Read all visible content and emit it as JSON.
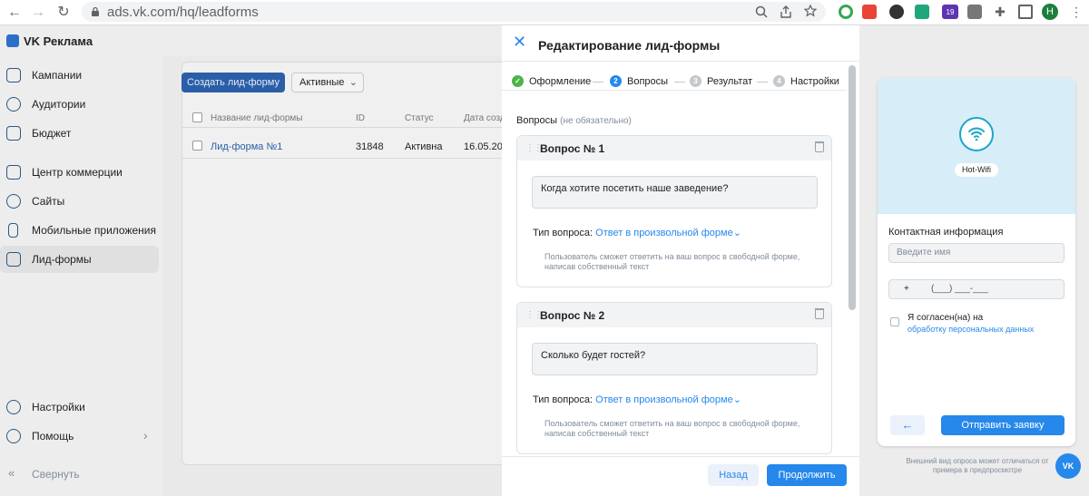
{
  "browser": {
    "url": "ads.vk.com/hq/leadforms",
    "back_icon": "←",
    "forward_icon": "→",
    "reload_icon": "↻",
    "extension_badge": "19",
    "profile_initial": "H"
  },
  "app": {
    "brand": "VK Реклама",
    "sidebar": {
      "items": [
        {
          "label": "Кампании"
        },
        {
          "label": "Аудитории"
        },
        {
          "label": "Бюджет"
        },
        {
          "label": "Центр коммерции"
        },
        {
          "label": "Сайты"
        },
        {
          "label": "Мобильные приложения"
        },
        {
          "label": "Лид-формы"
        }
      ],
      "bottom": [
        {
          "label": "Настройки"
        },
        {
          "label": "Помощь"
        },
        {
          "label": "Свернуть"
        }
      ]
    },
    "leads": {
      "create_button": "Создать лид-форму",
      "filter": "Активные",
      "columns": [
        "Название лид-формы",
        "ID",
        "Статус",
        "Дата созд"
      ],
      "rows": [
        {
          "name": "Лид-форма №1",
          "id": "31848",
          "status": "Активна",
          "date": "16.05.202"
        }
      ]
    }
  },
  "modal": {
    "title": "Редактирование лид-формы",
    "steps": [
      {
        "num": "✓",
        "label": "Оформление"
      },
      {
        "num": "2",
        "label": "Вопросы"
      },
      {
        "num": "3",
        "label": "Результат"
      },
      {
        "num": "4",
        "label": "Настройки"
      }
    ],
    "section_title": "Вопросы",
    "section_optional": "(не обязательно)",
    "questions": [
      {
        "title": "Вопрос № 1",
        "text": "Когда хотите посетить наше заведение?",
        "type_label": "Тип вопроса:",
        "type_value": "Ответ в произвольной форме",
        "hint": "Пользователь сможет ответить на ваш вопрос в свободной форме, написав собственный текст"
      },
      {
        "title": "Вопрос № 2",
        "text": "Сколько будет гостей?",
        "type_label": "Тип вопроса:",
        "type_value": "Ответ в произвольной форме",
        "hint": "Пользователь сможет ответить на ваш вопрос в свободной форме, написав собственный текст"
      }
    ],
    "back_button": "Назад",
    "next_button": "Продолжить"
  },
  "preview": {
    "brand_chip": "Hot-Wifi",
    "contact_title": "Контактная информация",
    "name_placeholder": "Введите имя",
    "phone_prefix": "+",
    "phone_mask": "(___) ___-___",
    "consent_text": "Я согласен(на) на",
    "consent_link": "обработку персональных данных",
    "submit_button": "Отправить заявку",
    "note": "Внешний вид опроса может отличаться от примера в предпросмотре",
    "chat_button": "VK"
  },
  "colors": {
    "accent": "#2688eb",
    "success": "#4bb34b",
    "wifi": "#19a7c8"
  }
}
